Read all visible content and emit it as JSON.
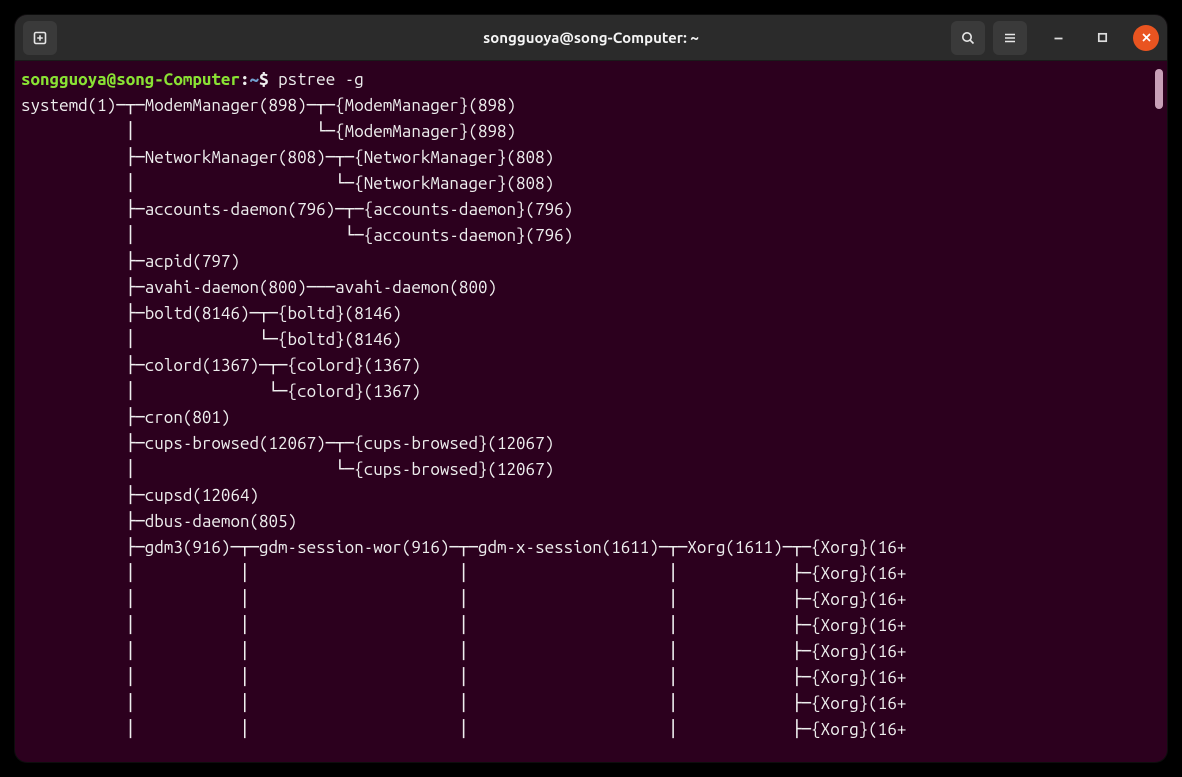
{
  "window": {
    "title": "songguoya@song-Computer: ~"
  },
  "prompt": {
    "user_host": "songguoya@song-Computer",
    "separator": ":",
    "path": "~",
    "symbol": "$",
    "command": "pstree -g"
  },
  "tree_lines": [
    "systemd(1)─┬─ModemManager(898)─┬─{ModemManager}(898)",
    "           │                   └─{ModemManager}(898)",
    "           ├─NetworkManager(808)─┬─{NetworkManager}(808)",
    "           │                     └─{NetworkManager}(808)",
    "           ├─accounts-daemon(796)─┬─{accounts-daemon}(796)",
    "           │                      └─{accounts-daemon}(796)",
    "           ├─acpid(797)",
    "           ├─avahi-daemon(800)───avahi-daemon(800)",
    "           ├─boltd(8146)─┬─{boltd}(8146)",
    "           │             └─{boltd}(8146)",
    "           ├─colord(1367)─┬─{colord}(1367)",
    "           │              └─{colord}(1367)",
    "           ├─cron(801)",
    "           ├─cups-browsed(12067)─┬─{cups-browsed}(12067)",
    "           │                     └─{cups-browsed}(12067)",
    "           ├─cupsd(12064)",
    "           ├─dbus-daemon(805)",
    "           ├─gdm3(916)─┬─gdm-session-wor(916)─┬─gdm-x-session(1611)─┬─Xorg(1611)─┬─{Xorg}(16+",
    "           │           │                      │                     │            ├─{Xorg}(16+",
    "           │           │                      │                     │            ├─{Xorg}(16+",
    "           │           │                      │                     │            ├─{Xorg}(16+",
    "           │           │                      │                     │            ├─{Xorg}(16+",
    "           │           │                      │                     │            ├─{Xorg}(16+",
    "           │           │                      │                     │            ├─{Xorg}(16+",
    "           │           │                      │                     │            ├─{Xorg}(16+"
  ]
}
